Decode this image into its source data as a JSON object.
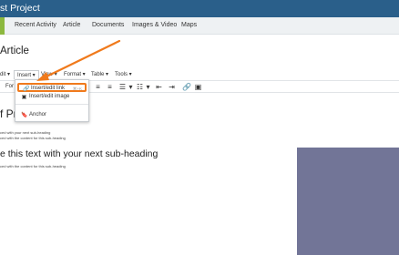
{
  "header": {
    "title": "st Project"
  },
  "nav": {
    "items": [
      "Recent Activity",
      "Article",
      "Documents",
      "Images & Video",
      "Maps"
    ]
  },
  "page": {
    "title": "Article"
  },
  "menubar": {
    "items": [
      "dit ▾",
      "Insert ▾",
      "View ▾",
      "Format ▾",
      "Table ▾",
      "Tools ▾"
    ]
  },
  "toolbar": {
    "format_label": "For"
  },
  "insert_menu": {
    "items": [
      {
        "label": "Insert/edit link",
        "shortcut": "⌘+K",
        "icon": "link-icon"
      },
      {
        "label": "Insert/edit image",
        "shortcut": "",
        "icon": "image-icon"
      },
      {
        "label": "Anchor",
        "shortcut": "",
        "icon": "bookmark-icon"
      }
    ]
  },
  "editor": {
    "heading1": "f Pro",
    "line1": "ced with your next sub-heading",
    "line2": "ced with the content for this sub-heading",
    "heading2": "e this text with your next sub-heading",
    "line3": "ced with the content for this sub-heading"
  },
  "colors": {
    "header_bg": "#2a5f8a",
    "nav_accent": "#8cb83f",
    "highlight": "#f07a1c",
    "image_bg": "#727597"
  }
}
